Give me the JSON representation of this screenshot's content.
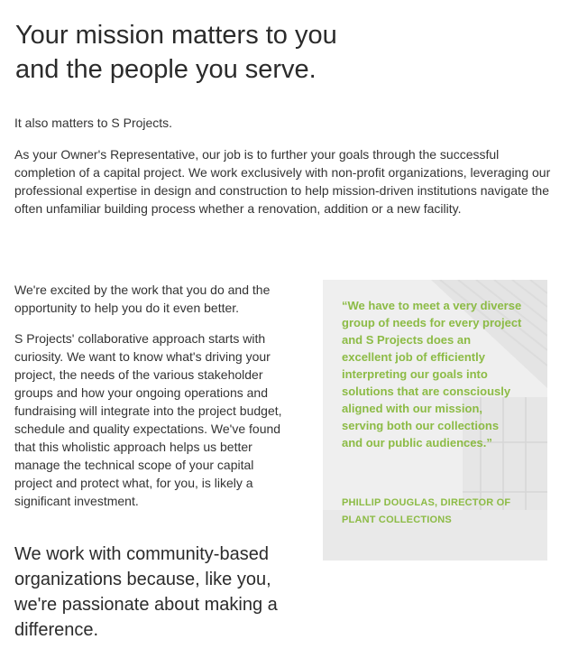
{
  "header": {
    "headline_line1": "Your mission matters to you",
    "headline_line2": "and the people you serve."
  },
  "intro": {
    "short": "It also matters to S Projects.",
    "body": "As your Owner's Representative, our job is to further your goals through the successful completion of a capital project. We work exclusively with non-profit organizations, leveraging our professional expertise in design and construction to help mission-driven institutions navigate the often unfamiliar building process whether a renovation, addition or a new facility."
  },
  "left_column": {
    "excited": "We're excited by the work that you do and the opportunity to help you do it even better.",
    "approach": "S Projects' collaborative approach starts with curiosity. We want to know what's driving your project, the needs of the various stakeholder groups and how your ongoing operations and fundraising will integrate into the project budget, schedule and quality expectations. We've found that this wholistic approach helps us better manage the technical scope of your capital project and protect what, for you, is likely a significant investment.",
    "closing": "We work with community-based organizations because, like you, we're passionate about making a difference."
  },
  "testimonial": {
    "quote": "“We have to meet a very diverse group of needs for every project and S Projects does an excellent job of efficiently interpreting our goals into solutions that are consciously aligned with our mission, serving both our collections and our public audiences.”",
    "attribution": "Phillip Douglas, Director of Plant Collections",
    "accent_color": "#8cbb45",
    "background": "greenhouse-photo-faded"
  }
}
